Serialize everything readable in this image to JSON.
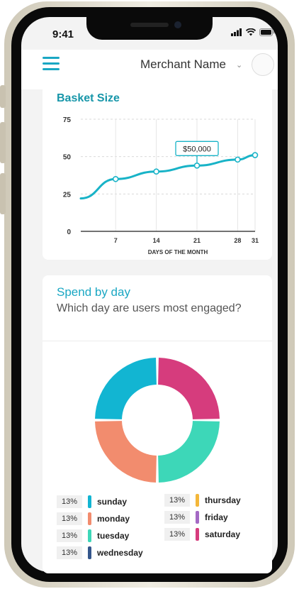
{
  "status": {
    "time": "9:41"
  },
  "header": {
    "merchant_name": "Merchant Name"
  },
  "basket": {
    "title": "Basket Size",
    "chart_data": {
      "type": "line",
      "title": "Basket Size",
      "xlabel": "DAYS OF THE MONTH",
      "ylabel": "",
      "x_ticks": [
        7,
        14,
        21,
        28,
        31
      ],
      "y_ticks": [
        0,
        25,
        50,
        75
      ],
      "ylim": [
        0,
        75
      ],
      "series": [
        {
          "x": [
            1,
            7,
            14,
            21,
            28,
            31
          ],
          "y": [
            22,
            35,
            40,
            44,
            48,
            51
          ]
        }
      ],
      "annotation": {
        "text": "$50,000",
        "x": 21
      },
      "grid": true
    }
  },
  "spend": {
    "title": "Spend by day",
    "subtitle": "Which day are users most engaged?",
    "chart_data": {
      "type": "pie",
      "donut": true,
      "slices": [
        {
          "label": "sunday",
          "percent": "13%",
          "value": 13,
          "color": "#12b5d2"
        },
        {
          "label": "monday",
          "percent": "13%",
          "value": 13,
          "color": "#f28c6e"
        },
        {
          "label": "tuesday",
          "percent": "13%",
          "value": 13,
          "color": "#3dd7b8"
        },
        {
          "label": "wednesday",
          "percent": "13%",
          "value": 13,
          "color": "#34568b"
        },
        {
          "label": "thursday",
          "percent": "13%",
          "value": 13,
          "color": "#f4b73a"
        },
        {
          "label": "friday",
          "percent": "13%",
          "value": 13,
          "color": "#a469c4"
        },
        {
          "label": "saturday",
          "percent": "13%",
          "value": 13,
          "color": "#d63c7d"
        }
      ]
    }
  }
}
